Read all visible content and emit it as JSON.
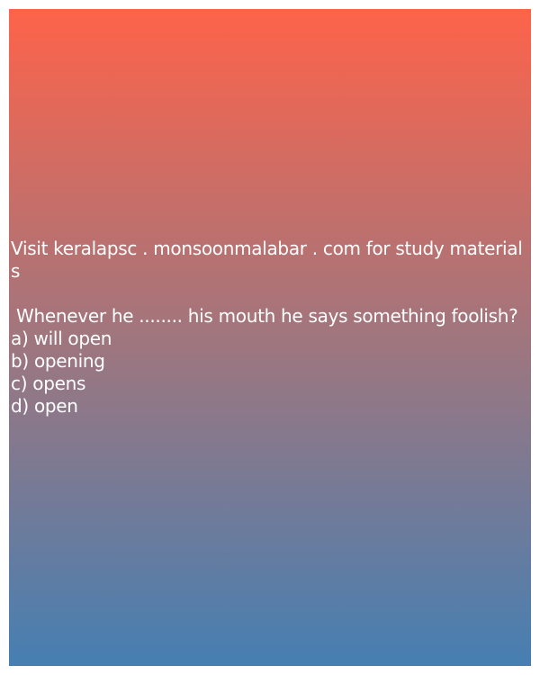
{
  "header": {
    "visit_text": "Visit keralapsc . monsoonmalabar . com for study materials"
  },
  "quiz": {
    "question": " Whenever he ........ his mouth he says something foolish?",
    "options": [
      "a) will open",
      "b) opening",
      "c) opens",
      "d) open"
    ]
  },
  "colors": {
    "gradient_top": "#fe634a",
    "gradient_middle": "#a0767e",
    "gradient_bottom": "#467fb2",
    "text": "#ffffff"
  }
}
